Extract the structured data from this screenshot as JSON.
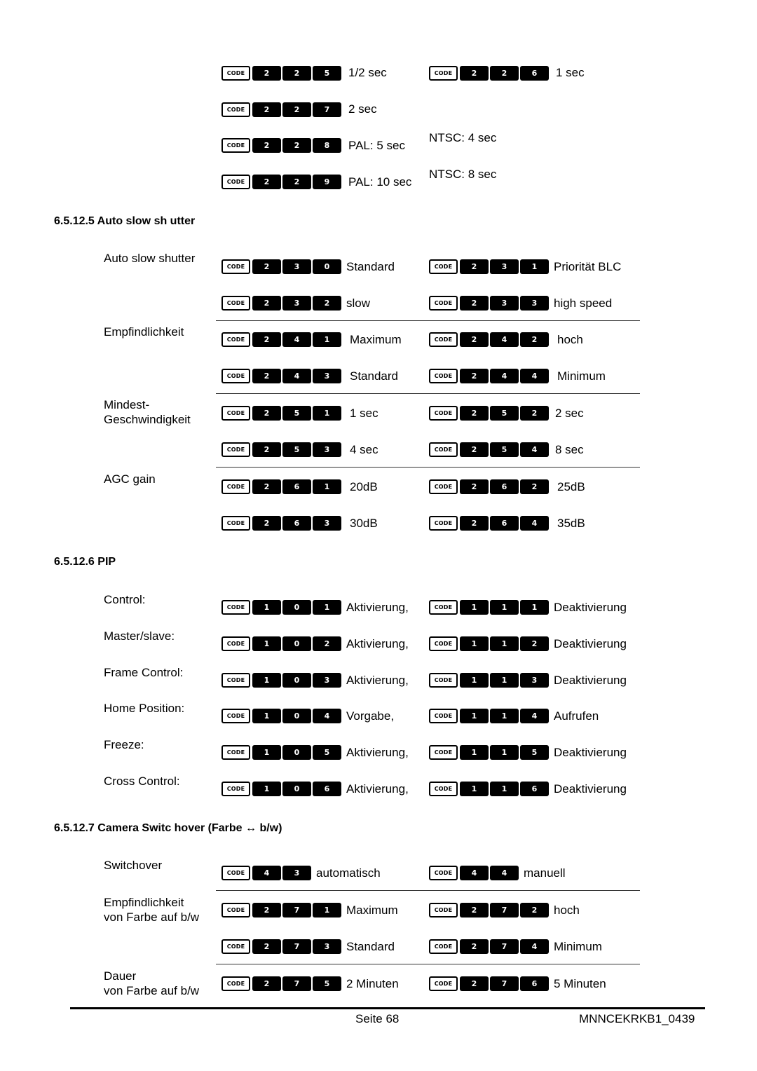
{
  "top_rows": [
    {
      "left": {
        "keys": [
          "2",
          "2",
          "5"
        ],
        "text": "1/2 sec"
      },
      "right": {
        "keys": [
          "2",
          "2",
          "6"
        ],
        "text": "1 sec"
      }
    },
    {
      "left": {
        "keys": [
          "2",
          "2",
          "7"
        ],
        "text": "2 sec"
      },
      "right": null
    },
    {
      "left": {
        "keys": [
          "2",
          "2",
          "8"
        ],
        "text": "PAL: 5 sec"
      },
      "right_text": "NTSC: 4 sec"
    },
    {
      "left": {
        "keys": [
          "2",
          "2",
          "9"
        ],
        "text": "PAL: 10 sec"
      },
      "right_text": "NTSC: 8 sec"
    }
  ],
  "code_key_label": "CODE",
  "sections": {
    "auto_slow_shutter": {
      "heading": "6.5.12.5 Auto slow sh utter",
      "groups": [
        {
          "label": "Auto slow shutter",
          "rows": [
            [
              {
                "keys": [
                  "2",
                  "3",
                  "0"
                ],
                "text": "Standard"
              },
              {
                "keys": [
                  "2",
                  "3",
                  "1"
                ],
                "text": "Priorität BLC"
              }
            ],
            [
              {
                "keys": [
                  "2",
                  "3",
                  "2"
                ],
                "text": "slow"
              },
              {
                "keys": [
                  "2",
                  "3",
                  "3"
                ],
                "text": "high speed"
              }
            ]
          ]
        },
        {
          "label": "Empfindlichkeit",
          "rows": [
            [
              {
                "keys": [
                  "2",
                  "4",
                  "1"
                ],
                "text": "Maximum"
              },
              {
                "keys": [
                  "2",
                  "4",
                  "2"
                ],
                "text": "hoch"
              }
            ],
            [
              {
                "keys": [
                  "2",
                  "4",
                  "3"
                ],
                "text": "Standard"
              },
              {
                "keys": [
                  "2",
                  "4",
                  "4"
                ],
                "text": "Minimum"
              }
            ]
          ]
        },
        {
          "label": "Mindest-\nGeschwindigkeit",
          "rows": [
            [
              {
                "keys": [
                  "2",
                  "5",
                  "1"
                ],
                "text": "1 sec"
              },
              {
                "keys": [
                  "2",
                  "5",
                  "2"
                ],
                "text": "2 sec"
              }
            ],
            [
              {
                "keys": [
                  "2",
                  "5",
                  "3"
                ],
                "text": "4 sec"
              },
              {
                "keys": [
                  "2",
                  "5",
                  "4"
                ],
                "text": "8 sec"
              }
            ]
          ]
        },
        {
          "label": "AGC gain",
          "rows": [
            [
              {
                "keys": [
                  "2",
                  "6",
                  "1"
                ],
                "text": "20dB"
              },
              {
                "keys": [
                  "2",
                  "6",
                  "2"
                ],
                "text": "25dB"
              }
            ],
            [
              {
                "keys": [
                  "2",
                  "6",
                  "3"
                ],
                "text": "30dB"
              },
              {
                "keys": [
                  "2",
                  "6",
                  "4"
                ],
                "text": "35dB"
              }
            ]
          ]
        }
      ]
    },
    "pip": {
      "heading": "6.5.12.6 PIP",
      "rows": [
        {
          "label": "Control:",
          "left": {
            "keys": [
              "1",
              "0",
              "1"
            ],
            "text": "Aktivierung,"
          },
          "right": {
            "keys": [
              "1",
              "1",
              "1"
            ],
            "text": "Deaktivierung"
          }
        },
        {
          "label": "Master/slave:",
          "left": {
            "keys": [
              "1",
              "0",
              "2"
            ],
            "text": "Aktivierung,"
          },
          "right": {
            "keys": [
              "1",
              "1",
              "2"
            ],
            "text": "Deaktivierung"
          }
        },
        {
          "label": "Frame Control:",
          "left": {
            "keys": [
              "1",
              "0",
              "3"
            ],
            "text": "Aktivierung,"
          },
          "right": {
            "keys": [
              "1",
              "1",
              "3"
            ],
            "text": "Deaktivierung"
          }
        },
        {
          "label": "Home Position:",
          "left": {
            "keys": [
              "1",
              "0",
              "4"
            ],
            "text": "Vorgabe,"
          },
          "right": {
            "keys": [
              "1",
              "1",
              "4"
            ],
            "text": "Aufrufen"
          }
        },
        {
          "label": "Freeze:",
          "left": {
            "keys": [
              "1",
              "0",
              "5"
            ],
            "text": "Aktivierung,"
          },
          "right": {
            "keys": [
              "1",
              "1",
              "5"
            ],
            "text": "Deaktivierung"
          }
        },
        {
          "label": "Cross Control:",
          "left": {
            "keys": [
              "1",
              "0",
              "6"
            ],
            "text": "Aktivierung,"
          },
          "right": {
            "keys": [
              "1",
              "1",
              "6"
            ],
            "text": "Deaktivierung"
          }
        }
      ]
    },
    "camera_switchover": {
      "heading": "6.5.12.7 Camera Switc hover (Farbe ↔ b/w)",
      "groups": [
        {
          "label": "Switchover",
          "rows": [
            [
              {
                "keys": [
                  "4",
                  "3"
                ],
                "text": "automatisch"
              },
              {
                "keys": [
                  "4",
                  "4"
                ],
                "text": "manuell"
              }
            ]
          ]
        },
        {
          "label": "Empfindlichkeit\nvon Farbe auf b/w",
          "rows": [
            [
              {
                "keys": [
                  "2",
                  "7",
                  "1"
                ],
                "text": "Maximum"
              },
              {
                "keys": [
                  "2",
                  "7",
                  "2"
                ],
                "text": "hoch"
              }
            ],
            [
              {
                "keys": [
                  "2",
                  "7",
                  "3"
                ],
                "text": "Standard"
              },
              {
                "keys": [
                  "2",
                  "7",
                  "4"
                ],
                "text": "Minimum"
              }
            ]
          ]
        },
        {
          "label": "Dauer\nvon Farbe auf b/w",
          "rows": [
            [
              {
                "keys": [
                  "2",
                  "7",
                  "5"
                ],
                "text": "2 Minuten"
              },
              {
                "keys": [
                  "2",
                  "7",
                  "6"
                ],
                "text": "5 Minuten"
              }
            ]
          ]
        }
      ]
    }
  },
  "footer": {
    "page": "Seite 68",
    "doc_id": "MNNCEKRKB1_0439"
  }
}
